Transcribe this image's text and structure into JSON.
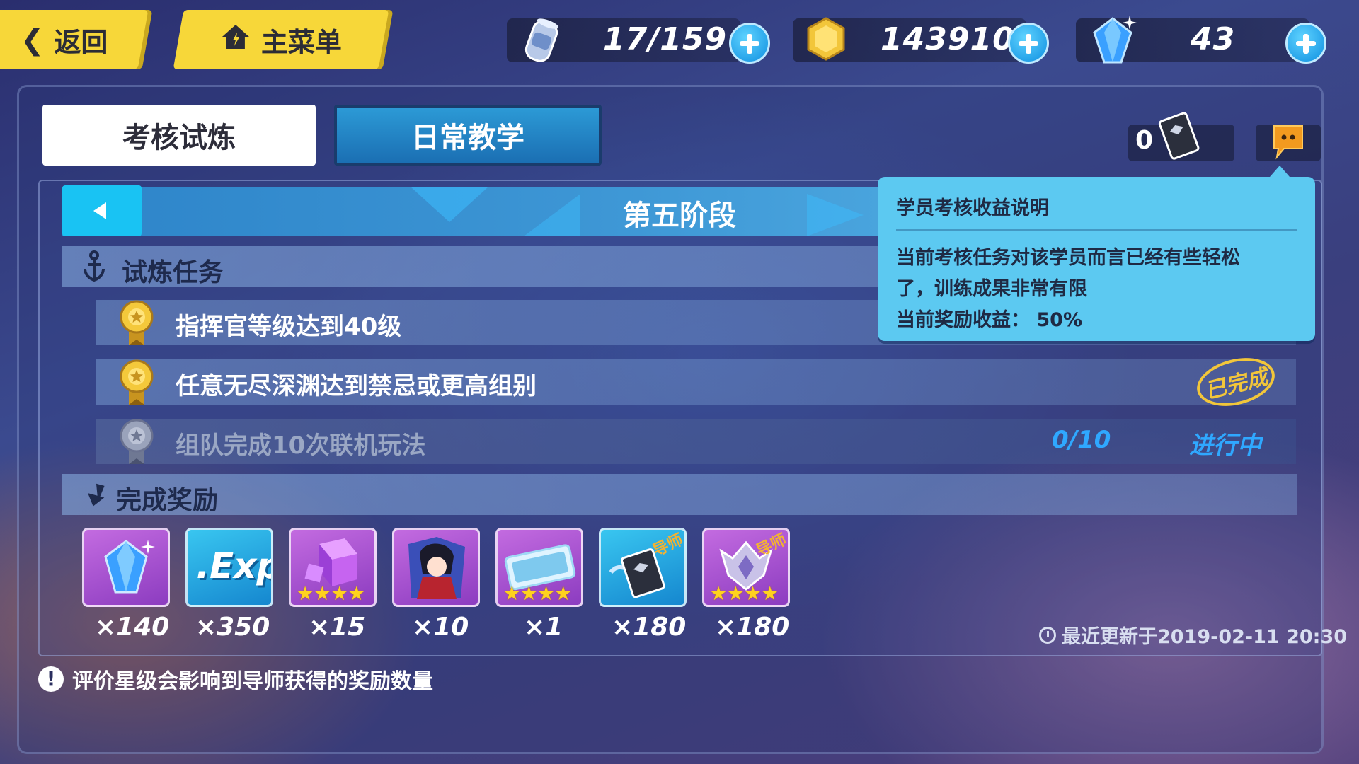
{
  "nav": {
    "back_label": "返回",
    "menu_label": "主菜单"
  },
  "resources": {
    "stamina": "17/159",
    "coins": "143910",
    "crystals": "43"
  },
  "tabs": {
    "active": "考核试炼",
    "inactive": "日常教学"
  },
  "book_count": "0",
  "stage": {
    "title": "第五阶段"
  },
  "sections": {
    "tasks_label": "试炼任务",
    "rewards_label": "完成奖励"
  },
  "tasks": [
    {
      "text": "指挥官等级达到40级"
    },
    {
      "text": "任意无尽深渊达到禁忌或更高组别",
      "stamp": "已完成"
    },
    {
      "text": "组队完成10次联机玩法",
      "progress": "0/10",
      "status": "进行中"
    }
  ],
  "rewards": [
    {
      "icon": "crystal-icon",
      "qty": "×140"
    },
    {
      "icon": "exp-icon",
      "label": ".Exp",
      "qty": "×350"
    },
    {
      "icon": "purple-cube-icon",
      "qty": "×15",
      "stars": 4
    },
    {
      "icon": "character-fragment-icon",
      "qty": "×10"
    },
    {
      "icon": "ticket-icon",
      "qty": "×1",
      "stars": 4
    },
    {
      "icon": "mentor-book-icon",
      "badge": "导师",
      "qty": "×180"
    },
    {
      "icon": "mentor-emblem-icon",
      "badge": "导师",
      "qty": "×180",
      "stars": 4
    }
  ],
  "tooltip": {
    "title": "学员考核收益说明",
    "line1": "当前考核任务对该学员而言已经有些轻松",
    "line2": "了，训练成果非常有限",
    "line3": "当前奖励收益：  50%"
  },
  "updated": "最近更新于2019-02-11 20:30",
  "notice": "评价星级会影响到导师获得的奖励数量",
  "colors": {
    "accent_yellow": "#f7d739",
    "accent_blue": "#19c3f3",
    "tooltip_bg": "#5cc9f1",
    "progress_blue": "#2fa8ff"
  }
}
